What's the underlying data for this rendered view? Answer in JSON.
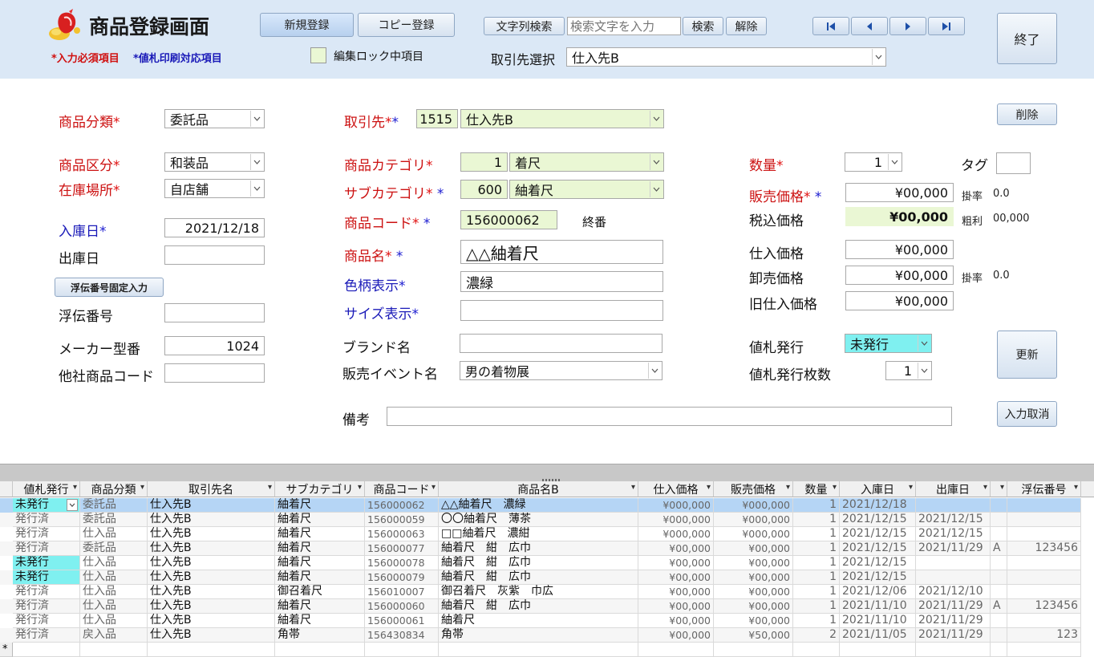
{
  "header": {
    "title": "商品登録画面",
    "legend_required": "*入力必須項目",
    "legend_print": "*値札印刷対応項目",
    "lock_legend": "編集ロック中項目",
    "btn_new": "新規登録",
    "btn_copy": "コピー登録",
    "btn_text_search": "文字列検索",
    "search_placeholder": "検索文字を入力",
    "btn_search": "検索",
    "btn_clear": "解除",
    "supplier_select_label": "取引先選択",
    "supplier_select_value": "仕入先B",
    "btn_exit": "終了"
  },
  "form": {
    "category": {
      "label": "商品分類",
      "value": "委託品"
    },
    "division": {
      "label": "商品区分",
      "value": "和装品"
    },
    "location": {
      "label": "在庫場所",
      "value": "自店舗"
    },
    "in_date": {
      "label": "入庫日",
      "value": "2021/12/18"
    },
    "out_date": {
      "label": "出庫日",
      "value": ""
    },
    "btn_slip_fixed": "浮伝番号固定入力",
    "slip_no": {
      "label": "浮伝番号",
      "value": ""
    },
    "maker_no": {
      "label": "メーカー型番",
      "value": "1024"
    },
    "other_code": {
      "label": "他社商品コード",
      "value": ""
    },
    "supplier": {
      "label": "取引先",
      "code": "1515",
      "name": "仕入先B"
    },
    "prod_category": {
      "label": "商品カテゴリ",
      "code": "1",
      "name": "着尺"
    },
    "sub_category": {
      "label": "サブカテゴリ",
      "code": "600",
      "name": "紬着尺"
    },
    "product_code": {
      "label": "商品コード",
      "value": "156000062",
      "note": "終番"
    },
    "product_name": {
      "label": "商品名",
      "value": "△△紬着尺"
    },
    "color": {
      "label": "色柄表示",
      "value": "濃緑"
    },
    "size": {
      "label": "サイズ表示",
      "value": ""
    },
    "brand": {
      "label": "ブランド名",
      "value": ""
    },
    "event": {
      "label": "販売イベント名",
      "value": "男の着物展"
    },
    "remarks": {
      "label": "備考",
      "value": ""
    },
    "quantity": {
      "label": "数量",
      "value": "1"
    },
    "tag": {
      "label": "タグ",
      "value": ""
    },
    "sale_price": {
      "label": "販売価格",
      "value": "¥00,000",
      "rate_label": "掛率",
      "rate": "0.0"
    },
    "tax_price": {
      "label": "税込価格",
      "value": "¥00,000",
      "margin_label": "粗利",
      "margin": "00,000"
    },
    "cost_price": {
      "label": "仕入価格",
      "value": "¥00,000"
    },
    "wholesale_price": {
      "label": "卸売価格",
      "value": "¥00,000",
      "rate_label": "掛率",
      "rate": "0.0"
    },
    "old_cost_price": {
      "label": "旧仕入価格",
      "value": "¥00,000"
    },
    "tag_issue": {
      "label": "値札発行",
      "value": "未発行"
    },
    "tag_count": {
      "label": "値札発行枚数",
      "value": "1"
    },
    "btn_delete": "削除",
    "btn_update": "更新",
    "btn_cancel": "入力取消"
  },
  "grid": {
    "columns": [
      "値札発行",
      "商品分類",
      "取引先名",
      "サブカテゴリ",
      "商品コード",
      "商品名B",
      "仕入価格",
      "販売価格",
      "数量",
      "入庫日",
      "出庫日",
      "",
      "浮伝番号"
    ],
    "rows": [
      [
        "未発行",
        "委託品",
        "仕入先B",
        "紬着尺",
        "156000062",
        "△△紬着尺　濃緑",
        "¥000,000",
        "¥000,000",
        "1",
        "2021/12/18",
        "",
        "",
        ""
      ],
      [
        "発行済",
        "委託品",
        "仕入先B",
        "紬着尺",
        "156000059",
        "〇〇紬着尺　薄茶",
        "¥000,000",
        "¥000,000",
        "1",
        "2021/12/15",
        "2021/12/15",
        "",
        ""
      ],
      [
        "発行済",
        "仕入品",
        "仕入先B",
        "紬着尺",
        "156000063",
        "□□紬着尺　濃紺",
        "¥000,000",
        "¥000,000",
        "1",
        "2021/12/15",
        "2021/12/15",
        "",
        ""
      ],
      [
        "発行済",
        "委託品",
        "仕入先B",
        "紬着尺",
        "156000077",
        "紬着尺　紺　広巾",
        "¥00,000",
        "¥00,000",
        "1",
        "2021/12/15",
        "2021/11/29",
        "A",
        "123456"
      ],
      [
        "未発行",
        "仕入品",
        "仕入先B",
        "紬着尺",
        "156000078",
        "紬着尺　紺　広巾",
        "¥00,000",
        "¥00,000",
        "1",
        "2021/12/15",
        "",
        "",
        ""
      ],
      [
        "未発行",
        "仕入品",
        "仕入先B",
        "紬着尺",
        "156000079",
        "紬着尺　紺　広巾",
        "¥00,000",
        "¥00,000",
        "1",
        "2021/12/15",
        "",
        "",
        ""
      ],
      [
        "発行済",
        "仕入品",
        "仕入先B",
        "御召着尺",
        "156010007",
        "御召着尺　灰紫　巾広",
        "¥00,000",
        "¥00,000",
        "1",
        "2021/12/06",
        "2021/12/10",
        "",
        ""
      ],
      [
        "発行済",
        "仕入品",
        "仕入先B",
        "紬着尺",
        "156000060",
        "紬着尺　紺　広巾",
        "¥00,000",
        "¥00,000",
        "1",
        "2021/11/10",
        "2021/11/29",
        "A",
        "123456"
      ],
      [
        "発行済",
        "仕入品",
        "仕入先B",
        "紬着尺",
        "156000061",
        "紬着尺",
        "¥00,000",
        "¥00,000",
        "1",
        "2021/11/10",
        "2021/11/29",
        "",
        ""
      ],
      [
        "発行済",
        "戻入品",
        "仕入先B",
        "角帯",
        "156430834",
        "角帯",
        "¥00,000",
        "¥50,000",
        "2",
        "2021/11/05",
        "2021/11/29",
        "",
        "123"
      ]
    ],
    "new_row_marker": "*"
  },
  "colors": {
    "header_bg": "#dbe8f6",
    "required": "#cc1111",
    "print": "#1a1ab8",
    "locked": "#eaf7d4",
    "unissued": "#7ff0f0",
    "selected_row": "#b5d5f5"
  }
}
